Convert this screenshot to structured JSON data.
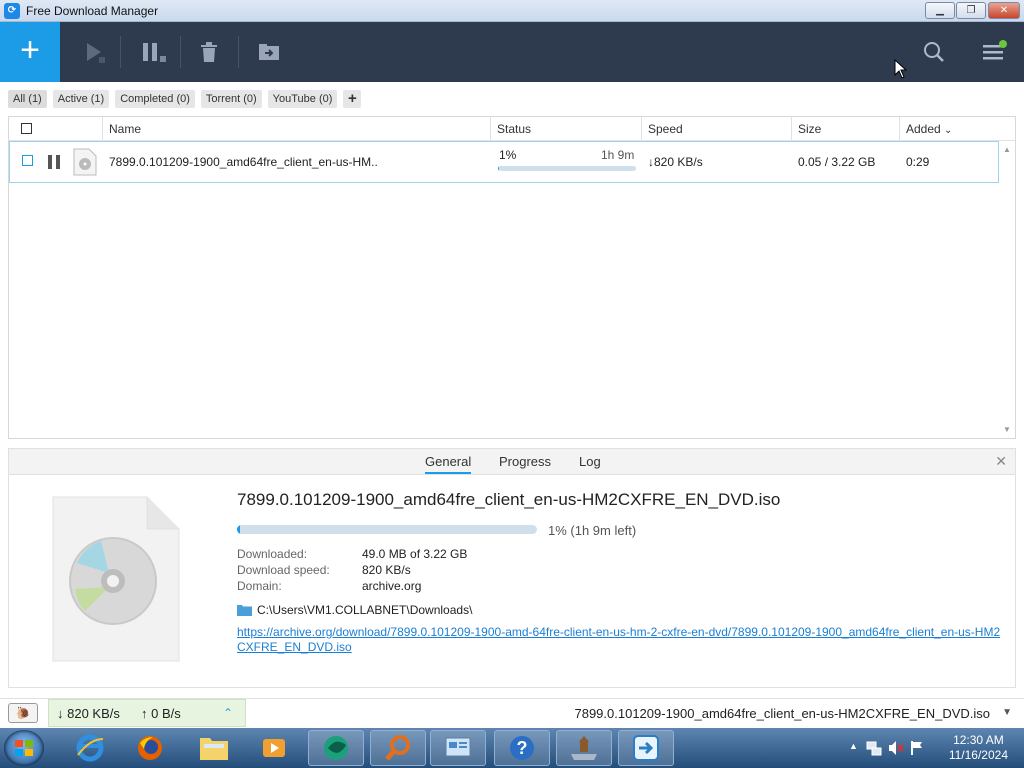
{
  "window": {
    "title": "Free Download Manager",
    "icon": "fdm-app-icon"
  },
  "toolbar": {
    "add_label": "+",
    "icons": [
      "add-icon",
      "play-icon",
      "pause-icon",
      "delete-icon",
      "move-icon",
      "search-icon",
      "menu-icon"
    ]
  },
  "filters": [
    {
      "label": "All (1)"
    },
    {
      "label": "Active (1)"
    },
    {
      "label": "Completed (0)"
    },
    {
      "label": "Torrent (0)"
    },
    {
      "label": "YouTube (0)"
    }
  ],
  "filters_plus": "+",
  "list": {
    "columns": {
      "name": "Name",
      "status": "Status",
      "speed": "Speed",
      "size": "Size",
      "added": "Added"
    },
    "sort_indicator": "⌄",
    "rows": [
      {
        "name": "7899.0.101209-1900_amd64fre_client_en-us-HM..",
        "progress_text": "1%",
        "progress_fraction": 0.01,
        "time_left": "1h 9m",
        "speed": "↓820 KB/s",
        "size": "0.05 / 3.22 GB",
        "added": "0:29"
      }
    ]
  },
  "details": {
    "tabs": [
      "General",
      "Progress",
      "Log"
    ],
    "selected_tab": "General",
    "close": "✕",
    "filename": "7899.0.101209-1900_amd64fre_client_en-us-HM2CXFRE_EN_DVD.iso",
    "progress_fraction": 0.01,
    "progress_text": "1% (1h 9m left)",
    "downloaded_label": "Downloaded:",
    "downloaded_value": "49.0 MB of 3.22 GB",
    "speed_label": "Download speed:",
    "speed_value": "820 KB/s",
    "domain_label": "Domain:",
    "domain_value": "archive.org",
    "path": "C:\\Users\\VM1.COLLABNET\\Downloads\\",
    "url": "https://archive.org/download/7899.0.101209-1900-amd-64fre-client-en-us-hm-2-cxfre-en-dvd/7899.0.101209-1900_amd64fre_client_en-us-HM2CXFRE_EN_DVD.iso"
  },
  "statusbar": {
    "down": "↓ 820 KB/s",
    "up": "↑ 0 B/s",
    "file": "7899.0.101209-1900_amd64fre_client_en-us-HM2CXFRE_EN_DVD.iso"
  },
  "taskbar": {
    "apps": [
      "internet-explorer-icon",
      "firefox-icon",
      "file-explorer-icon",
      "media-player-icon",
      "app-icon",
      "magnifier-icon",
      "control-panel-icon",
      "help-icon",
      "installer-icon",
      "fdm-icon"
    ],
    "clock_time": "12:30 AM",
    "clock_date": "11/16/2024"
  }
}
